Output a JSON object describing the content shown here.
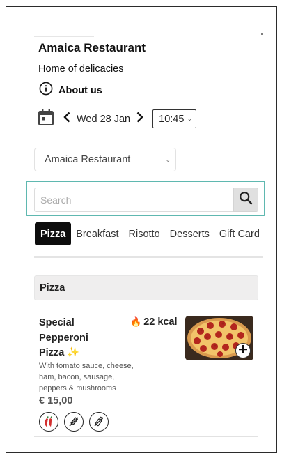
{
  "restaurant": {
    "name": "Amaica Restaurant",
    "tagline": "Home of delicacies",
    "about_label": "About us"
  },
  "schedule": {
    "date_label": "Wed 28 Jan",
    "time_value": "10:45"
  },
  "location_select": {
    "selected": "Amaica Restaurant"
  },
  "search": {
    "placeholder": "Search"
  },
  "categories": [
    {
      "label": "Pizza",
      "active": true
    },
    {
      "label": "Breakfast",
      "active": false
    },
    {
      "label": "Risotto",
      "active": false
    },
    {
      "label": "Desserts",
      "active": false
    },
    {
      "label": "Gift Card",
      "active": false
    }
  ],
  "section": {
    "title": "Pizza"
  },
  "menu_item": {
    "name_line1": "Special",
    "name_line2": "Pepperoni",
    "name_line3": "Pizza",
    "name_emoji": "✨",
    "kcal_icon": "🔥",
    "kcal": "22 kcal",
    "description": "With tomato sauce, cheese, ham, bacon, sausage, peppers & mushrooms",
    "price": "€ 15,00",
    "badges": [
      "chili-pepper-icon",
      "no-syringe-icon",
      "no-bottle-icon"
    ]
  },
  "colors": {
    "accent_focus": "#5fb8b0",
    "active_tab_bg": "#0d0d0d",
    "section_bg": "#efeeee",
    "chili_red": "#d32f2f",
    "chili_green": "#2e7d32"
  }
}
